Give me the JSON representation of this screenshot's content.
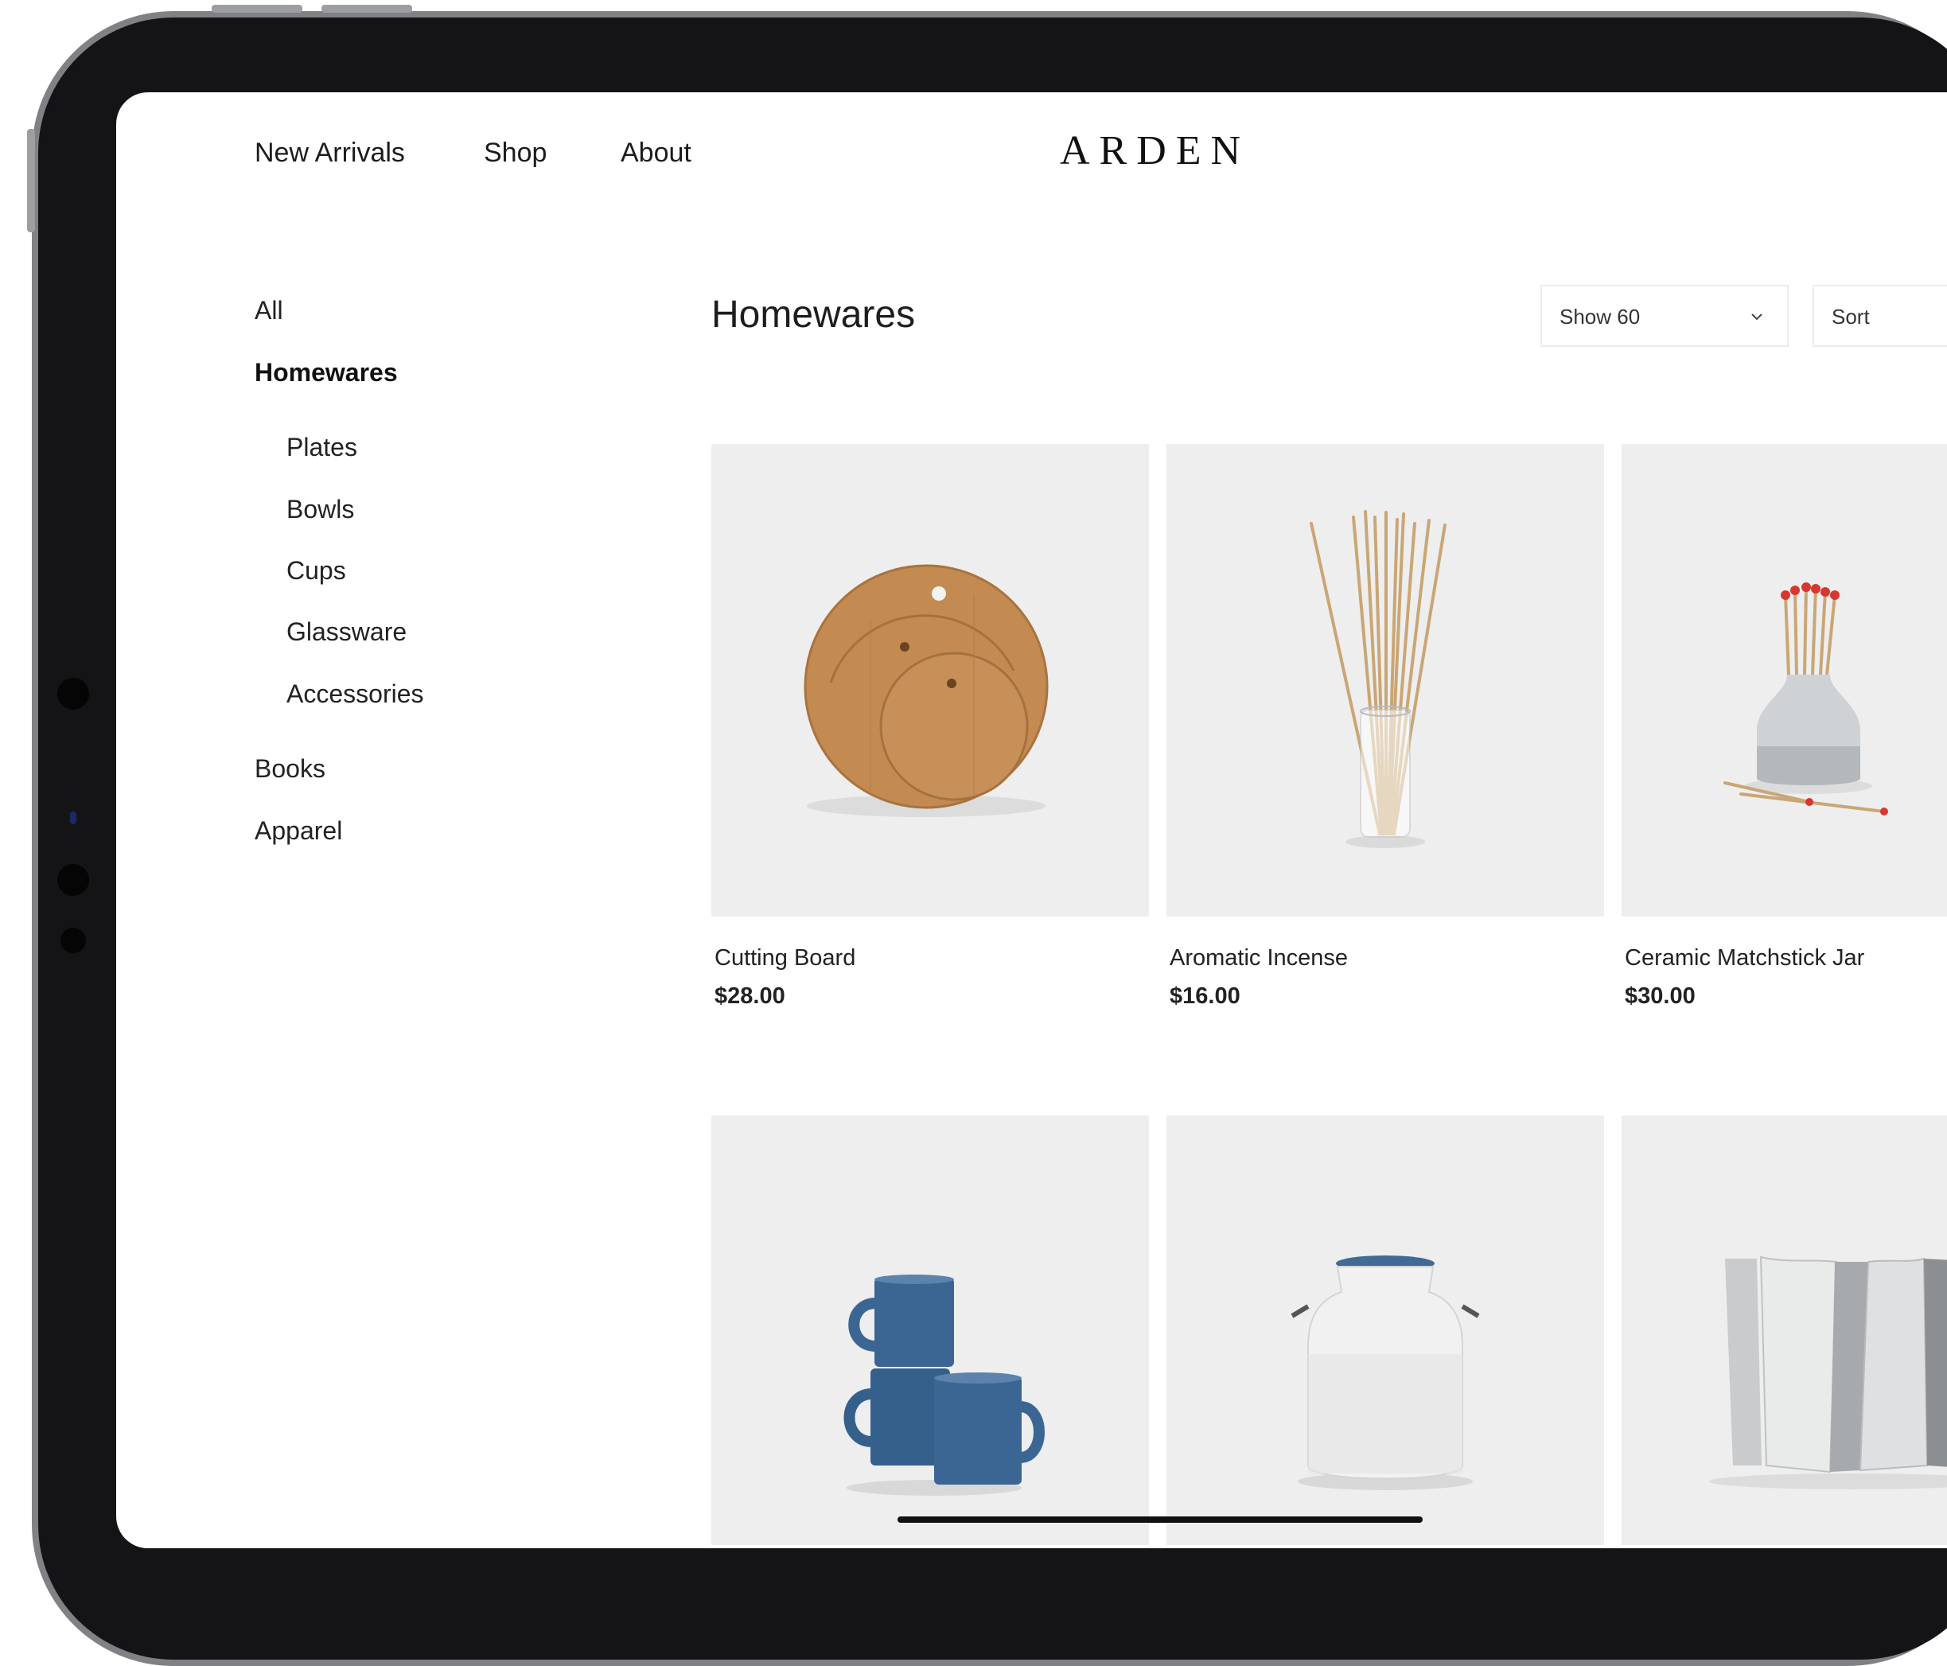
{
  "nav": {
    "links": [
      "New Arrivals",
      "Shop",
      "About"
    ],
    "brand": "ARDEN"
  },
  "sidebar": {
    "items": [
      {
        "label": "All",
        "level": 0,
        "active": false
      },
      {
        "label": "Homewares",
        "level": 0,
        "active": true
      },
      {
        "label": "Plates",
        "level": 1,
        "active": false
      },
      {
        "label": "Bowls",
        "level": 1,
        "active": false
      },
      {
        "label": "Cups",
        "level": 1,
        "active": false
      },
      {
        "label": "Glassware",
        "level": 1,
        "active": false
      },
      {
        "label": "Accessories",
        "level": 1,
        "active": false
      },
      {
        "label": "Books",
        "level": 0,
        "active": false
      },
      {
        "label": "Apparel",
        "level": 0,
        "active": false
      }
    ]
  },
  "main": {
    "title": "Homewares",
    "filters": {
      "show_value": "Show 60",
      "sort_value": "Sort"
    },
    "products": [
      {
        "name": "Cutting Board",
        "price": "$28.00",
        "image_icon": "cutting-board-icon"
      },
      {
        "name": "Aromatic Incense",
        "price": "$16.00",
        "image_icon": "incense-icon"
      },
      {
        "name": "Ceramic Matchstick Jar",
        "price": "$30.00",
        "image_icon": "matchstick-jar-icon"
      },
      {
        "name": "",
        "price": "",
        "image_icon": "enamel-mugs-icon"
      },
      {
        "name": "",
        "price": "",
        "image_icon": "milk-jug-icon"
      },
      {
        "name": "",
        "price": "",
        "image_icon": "glass-vase-icon"
      }
    ]
  },
  "colors": {
    "card_bg": "#eeeeee",
    "bezel": "#141416",
    "text": "#1c1c1c",
    "mug_blue": "#3b6694",
    "wood": "#c08a52"
  }
}
